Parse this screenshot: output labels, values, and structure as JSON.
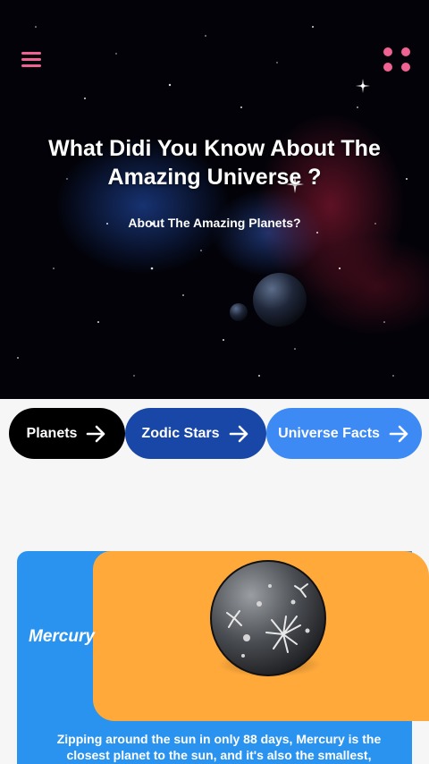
{
  "hero": {
    "title": "What Didi You Know About The Amazing Universe ?",
    "subtitle": "About The Amazing Planets?"
  },
  "header": {
    "menu_icon": "hamburger-menu-icon",
    "apps_icon": "four-dots-grid-icon",
    "icon_color": "#f06292"
  },
  "tabs": [
    {
      "label": "Planets",
      "color": "#000000"
    },
    {
      "label": "Zodic Stars",
      "color": "#1847a8"
    },
    {
      "label": "Universe Facts",
      "color": "#3d8af5"
    }
  ],
  "card": {
    "title": "Mercury",
    "description": "Zipping around the sun in only 88 days, Mercury is the closest planet to the sun, and it's also the smallest,",
    "colors": {
      "panel": "#2a93ef",
      "image_bg": "#ffa93b"
    }
  }
}
